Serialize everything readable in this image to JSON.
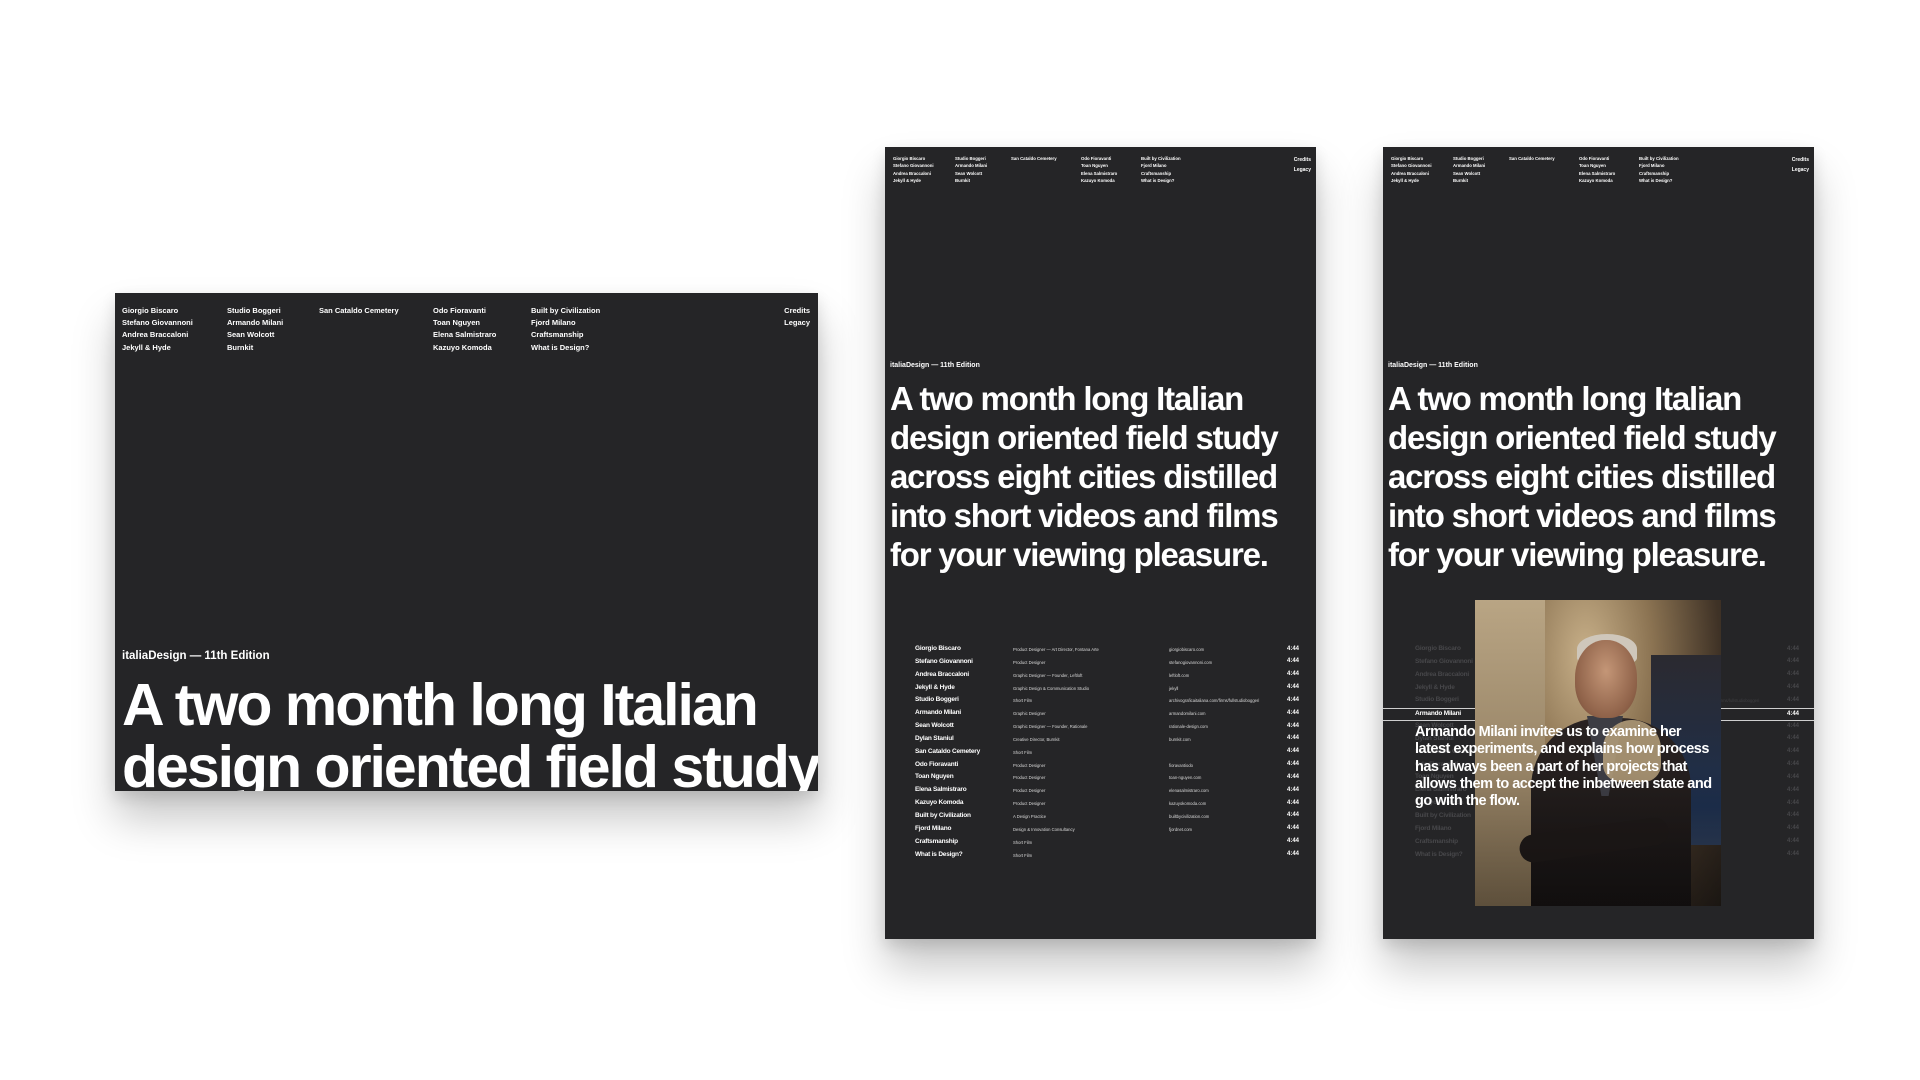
{
  "site": {
    "edition_desktop": "italiaDesign — 11th Edition",
    "edition_mobile": "italiaDesign — 11th Edition",
    "headline": "A two month long Italian design oriented field study across eight cities distilled into short videos and films for your viewing pleasure."
  },
  "nav": {
    "col1": [
      "Giorgio Biscaro",
      "Stefano Giovannoni",
      "Andrea Braccaloni",
      "Jekyll & Hyde"
    ],
    "col2": [
      "Studio Boggeri",
      "Armando Milani",
      "Sean Wolcott",
      "Burnkit"
    ],
    "col3": [
      "San Cataldo Cemetery"
    ],
    "col4": [
      "Odo Fioravanti",
      "Toan Nguyen",
      "Elena Salmistraro",
      "Kazuyo Komoda"
    ],
    "col5": [
      "Built by Civilization",
      "Fjord Milano",
      "Craftsmanship",
      "What is Design?"
    ],
    "right": [
      "Credits",
      "Legacy"
    ]
  },
  "videos": [
    {
      "name": "Giorgio Biscaro",
      "role": "Product Designer — Art Director, Fontana Arte",
      "site": "giorgiobiscaro.com",
      "duration": "4:44"
    },
    {
      "name": "Stefano Giovannoni",
      "role": "Product Designer",
      "site": "stefanogiovannoni.com",
      "duration": "4:44"
    },
    {
      "name": "Andrea Braccaloni",
      "role": "Graphic Designer — Founder, Leftloft",
      "site": "leftloft.com",
      "duration": "4:44"
    },
    {
      "name": "Jekyll & Hyde",
      "role": "Graphic Design & Communication Studio",
      "site": "jekyll",
      "duration": "4:44"
    },
    {
      "name": "Studio Boggeri",
      "role": "Short Film",
      "site": "archivograficaitaliana.com/firms/fullstudioboggeri",
      "duration": "4:44"
    },
    {
      "name": "Armando Milani",
      "role": "Graphic Designer",
      "site": "armandomilani.com",
      "duration": "4:44"
    },
    {
      "name": "Sean Wolcott",
      "role": "Graphic Designer — Founder, Rationale",
      "site": "rationale-design.com",
      "duration": "4:44"
    },
    {
      "name": "Dylan Staniul",
      "role": "Creative Director, Burnkit",
      "site": "burnkit.com",
      "duration": "4:44"
    },
    {
      "name": "San Cataldo Cemetery",
      "role": "Short Film",
      "site": "",
      "duration": "4:44"
    },
    {
      "name": "Odo Fioravanti",
      "role": "Product Designer",
      "site": "fioravantiodo",
      "duration": "4:44"
    },
    {
      "name": "Toan Nguyen",
      "role": "Product Designer",
      "site": "toan-nguyen.com",
      "duration": "4:44"
    },
    {
      "name": "Elena Salmistraro",
      "role": "Product Designer",
      "site": "elenasalmistraro.com",
      "duration": "4:44"
    },
    {
      "name": "Kazuyo Komoda",
      "role": "Product Designer",
      "site": "kazuyokomoda.com",
      "duration": "4:44"
    },
    {
      "name": "Built by Civilization",
      "role": "A Design Practice",
      "site": "builtbycivilization.com",
      "duration": "4:44"
    },
    {
      "name": "Fjord Milano",
      "role": "Design & Innovation Consultancy",
      "site": "fjordnet.com",
      "duration": "4:44"
    },
    {
      "name": "Craftsmanship",
      "role": "Short Film",
      "site": "",
      "duration": "4:44"
    },
    {
      "name": "What is Design?",
      "role": "Short Film",
      "site": "",
      "duration": "4:44"
    }
  ],
  "active_video": "Armando Milani",
  "quote": "Armando Milani invites us to examine her latest experiments, and explains how process has always been a part of her projects that allows them to accept the inbetween state and go with the flow.",
  "photo_icon": "portrait-photo"
}
